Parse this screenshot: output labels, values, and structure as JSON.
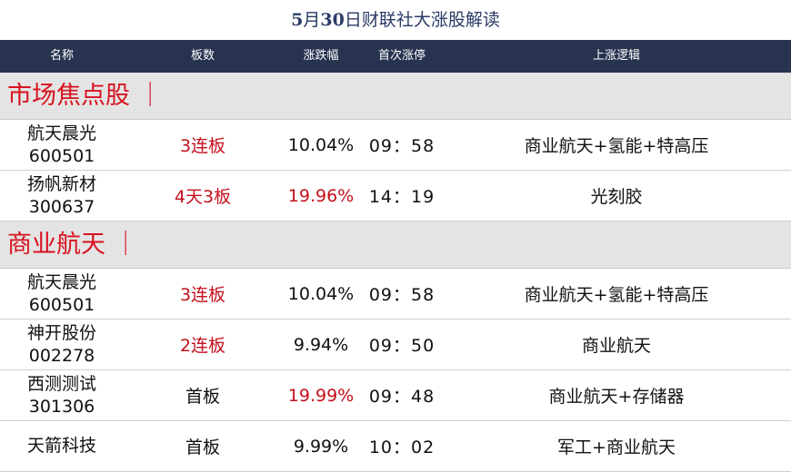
{
  "title_prefix": "5",
  "title_mid": "月",
  "title_num": "30",
  "title_rest": "日财联社大涨股解读",
  "headers": {
    "name": "名称",
    "boards": "板数",
    "change": "涨跌幅",
    "first_limit": "首次涨停",
    "logic": "上涨逻辑"
  },
  "sections": [
    {
      "title": "市场焦点股 ｜",
      "rows": [
        {
          "name": "航天晨光",
          "code": "600501",
          "boards": "3连板",
          "boards_red": true,
          "change": "10.04%",
          "change_red": false,
          "first_limit": "09：58",
          "logic": "商业航天+氢能+特高压"
        },
        {
          "name": "扬帆新材",
          "code": "300637",
          "boards": "4天3板",
          "boards_red": true,
          "change": "19.96%",
          "change_red": true,
          "first_limit": "14：19",
          "logic": "光刻胶"
        }
      ]
    },
    {
      "title": "商业航天 ｜",
      "rows": [
        {
          "name": "航天晨光",
          "code": "600501",
          "boards": "3连板",
          "boards_red": true,
          "change": "10.04%",
          "change_red": false,
          "first_limit": "09：58",
          "logic": "商业航天+氢能+特高压"
        },
        {
          "name": "神开股份",
          "code": "002278",
          "boards": "2连板",
          "boards_red": true,
          "change": "9.94%",
          "change_red": false,
          "first_limit": "09：50",
          "logic": "商业航天"
        },
        {
          "name": "西测测试",
          "code": "301306",
          "boards": "首板",
          "boards_red": false,
          "change": "19.99%",
          "change_red": true,
          "first_limit": "09：48",
          "logic": "商业航天+存储器"
        },
        {
          "name": "天箭科技",
          "code": "",
          "boards": "首板",
          "boards_red": false,
          "change": "9.99%",
          "change_red": false,
          "first_limit": "10：02",
          "logic": "军工+商业航天"
        }
      ]
    }
  ]
}
